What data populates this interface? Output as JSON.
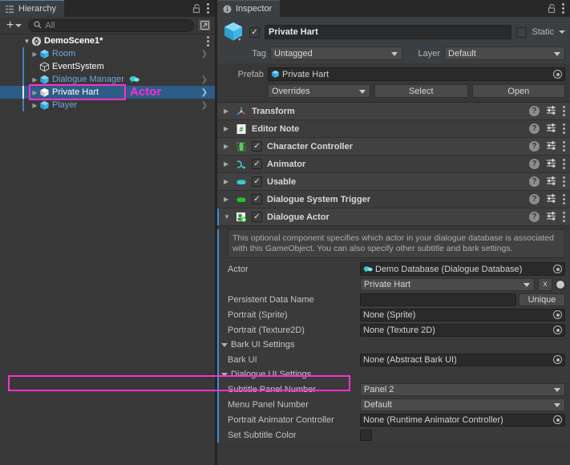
{
  "hierarchy": {
    "tab_label": "Hierarchy",
    "tab_icon": "hierarchy-icon",
    "lock_icon": "lock-open-icon",
    "menu_icon": "kebab-menu-icon",
    "toolbar": {
      "add_label": "+",
      "search_placeholder": "All",
      "search_value": "",
      "search_icon": "search-icon",
      "window_icon": "open-window-icon"
    },
    "scene": {
      "label": "DemoScene1*",
      "icon": "unity-scene-icon"
    },
    "items": [
      {
        "label": "Room",
        "icon": "prefab-cube-icon",
        "indent": 2,
        "expandable": true,
        "selected": false,
        "has_chevron": true,
        "extra_icon": ""
      },
      {
        "label": "EventSystem",
        "icon": "gameobject-cube-icon",
        "indent": 2,
        "expandable": false,
        "selected": false,
        "has_chevron": false,
        "extra_icon": ""
      },
      {
        "label": "Dialogue Manager",
        "icon": "prefab-cube-icon",
        "indent": 2,
        "expandable": true,
        "selected": false,
        "has_chevron": true,
        "extra_icon": "speech-bubble-icon"
      },
      {
        "label": "Private Hart",
        "icon": "prefab-cube-icon",
        "indent": 2,
        "expandable": true,
        "selected": true,
        "has_chevron": true,
        "extra_icon": ""
      },
      {
        "label": "Player",
        "icon": "prefab-cube-icon",
        "indent": 2,
        "expandable": true,
        "selected": false,
        "has_chevron": true,
        "extra_icon": ""
      }
    ],
    "annotation": "Actor"
  },
  "inspector": {
    "tab_label": "Inspector",
    "tab_icon": "info-icon",
    "lock_icon": "lock-open-icon",
    "menu_icon": "kebab-menu-icon",
    "gameobject": {
      "icon": "prefab-cube-icon",
      "enabled": true,
      "name": "Private Hart",
      "static_label": "Static",
      "static_checked": false,
      "tag_label": "Tag",
      "tag_value": "Untagged",
      "layer_label": "Layer",
      "layer_value": "Default"
    },
    "prefab": {
      "label": "Prefab",
      "value": "Private Hart",
      "value_icon": "prefab-cube-icon",
      "overrides_label": "Overrides",
      "select_label": "Select",
      "open_label": "Open"
    },
    "components": [
      {
        "name": "Transform",
        "icon": "transform-icon",
        "has_checkbox": false,
        "checked": false,
        "expanded": false
      },
      {
        "name": "Editor Note",
        "icon": "script-hash-icon",
        "has_checkbox": false,
        "checked": false,
        "expanded": false
      },
      {
        "name": "Character Controller",
        "icon": "capsule-collider-icon",
        "has_checkbox": true,
        "checked": true,
        "expanded": false
      },
      {
        "name": "Animator",
        "icon": "animator-icon",
        "has_checkbox": true,
        "checked": true,
        "expanded": false
      },
      {
        "name": "Usable",
        "icon": "teal-script-icon",
        "has_checkbox": true,
        "checked": true,
        "expanded": false
      },
      {
        "name": "Dialogue System Trigger",
        "icon": "green-script-icon",
        "has_checkbox": true,
        "checked": true,
        "expanded": false
      },
      {
        "name": "Dialogue Actor",
        "icon": "dialogue-actor-icon",
        "has_checkbox": true,
        "checked": true,
        "expanded": true
      }
    ],
    "dialogue_actor": {
      "help_text": "This optional component specifies which actor in your dialogue database is associated with this GameObject. You can also specify other subtitle and bark settings.",
      "actor_label": "Actor",
      "actor_database": "Demo Database (Dialogue Database)",
      "actor_database_icon": "dialogue-database-icon",
      "actor_name": "Private Hart",
      "actor_clear_label": "x",
      "persistent_label": "Persistent Data Name",
      "persistent_value": "",
      "unique_label": "Unique",
      "portrait_sprite_label": "Portrait (Sprite)",
      "portrait_sprite_value": "None (Sprite)",
      "portrait_texture_label": "Portrait (Texture2D)",
      "portrait_texture_value": "None (Texture 2D)",
      "bark_section_label": "Bark UI Settings",
      "bark_ui_label": "Bark UI",
      "bark_ui_value": "None (Abstract Bark UI)",
      "dialogue_section_label": "Dialogue UI Settings",
      "subtitle_panel_label": "Subtitle Panel Number",
      "subtitle_panel_value": "Panel 2",
      "menu_panel_label": "Menu Panel Number",
      "menu_panel_value": "Default",
      "portrait_animator_label": "Portrait Animator Controller",
      "portrait_animator_value": "None (Runtime Animator Controller)",
      "set_subtitle_color_label": "Set Subtitle Color",
      "set_subtitle_color_checked": false
    }
  },
  "colors": {
    "highlight": "#ff2fd0",
    "selection": "#2c5d87",
    "accent_blue": "#4d7ebd",
    "panel_bg": "#383838",
    "inspector_bg": "#3c3f41"
  }
}
